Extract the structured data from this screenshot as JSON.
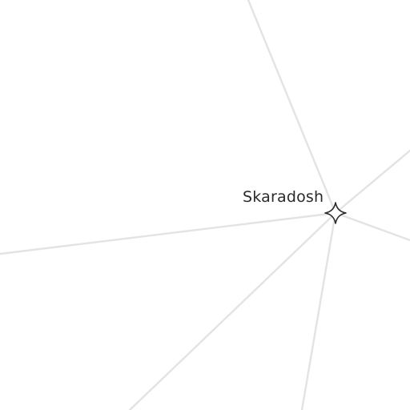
{
  "map": {
    "place": {
      "name": "Skaradosh",
      "icon": "star-marker-icon"
    },
    "road_color": "#e3e3e3",
    "marker_color": "#2a2a2a"
  }
}
